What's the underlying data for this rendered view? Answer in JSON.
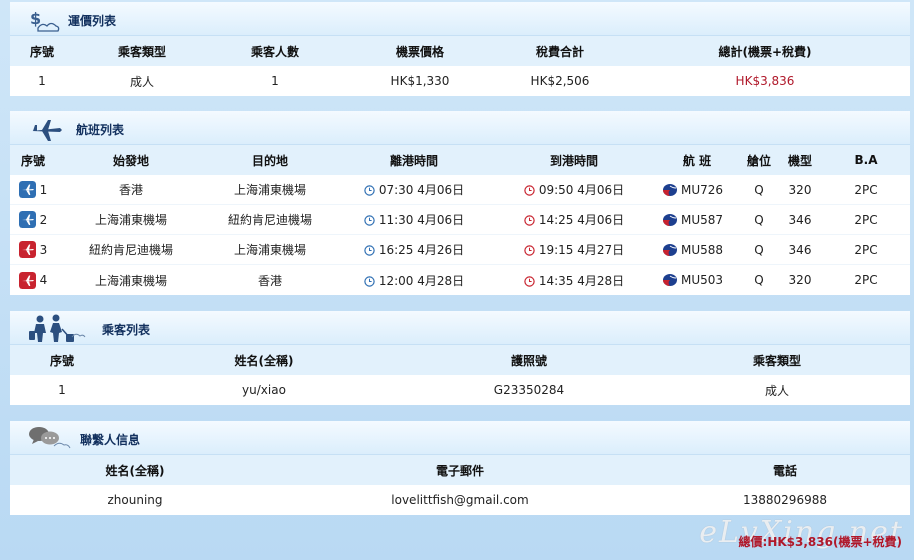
{
  "fare": {
    "title": "運價列表",
    "headers": [
      "序號",
      "乘客類型",
      "乘客人數",
      "機票價格",
      "稅費合計",
      "總計(機票+稅費)"
    ],
    "rows": [
      [
        "1",
        "成人",
        "1",
        "HK$1,330",
        "HK$2,506",
        "HK$3,836"
      ]
    ]
  },
  "flights": {
    "title": "航班列表",
    "headers": [
      "序號",
      "始發地",
      "目的地",
      "離港時間",
      "到港時間",
      "航 班",
      "艙位",
      "機型",
      "B.A"
    ],
    "rows": [
      {
        "num": "1",
        "from": "香港",
        "to": "上海浦東機場",
        "dep": "07:30 4月06日",
        "arr": "09:50 4月06日",
        "flight": "MU726",
        "cabin": "Q",
        "model": "320",
        "ba": "2PC",
        "badge": "depart"
      },
      {
        "num": "2",
        "from": "上海浦東機場",
        "to": "紐約肯尼迪機場",
        "dep": "11:30 4月06日",
        "arr": "14:25 4月06日",
        "flight": "MU587",
        "cabin": "Q",
        "model": "346",
        "ba": "2PC",
        "badge": "depart"
      },
      {
        "num": "3",
        "from": "紐約肯尼迪機場",
        "to": "上海浦東機場",
        "dep": "16:25 4月26日",
        "arr": "19:15 4月27日",
        "flight": "MU588",
        "cabin": "Q",
        "model": "346",
        "ba": "2PC",
        "badge": "return"
      },
      {
        "num": "4",
        "from": "上海浦東機場",
        "to": "香港",
        "dep": "12:00 4月28日",
        "arr": "14:35 4月28日",
        "flight": "MU503",
        "cabin": "Q",
        "model": "320",
        "ba": "2PC",
        "badge": "return"
      }
    ]
  },
  "passengers": {
    "title": "乘客列表",
    "headers": [
      "序號",
      "姓名(全稱)",
      "護照號",
      "乘客類型"
    ],
    "rows": [
      [
        "1",
        "yu/xiao",
        "G23350284",
        "成人"
      ]
    ]
  },
  "contact": {
    "title": "聯繫人信息",
    "headers": [
      "姓名(全稱)",
      "電子郵件",
      "電話"
    ],
    "rows": [
      [
        "zhouning",
        "lovelittfish@gmail.com",
        "13880296988"
      ]
    ]
  },
  "footer": {
    "total": "總價:HK$3,836(機票+稅費)",
    "watermark": "eLvXing.net"
  },
  "icons": {
    "fare": "money-cloud-icon",
    "flights": "airplane-icon",
    "passengers": "passengers-luggage-icon",
    "contact": "chat-bubbles-icon",
    "depart_badge": "departure-plane-icon",
    "return_badge": "arrival-plane-icon",
    "dep_clock": "departure-clock-icon",
    "arr_clock": "arrival-clock-icon",
    "airline": "china-eastern-logo-icon"
  },
  "colors": {
    "depart_badge": "#2f6fb3",
    "return_badge": "#c8232f",
    "total_red": "#b0182a",
    "header_navy": "#12305e"
  }
}
